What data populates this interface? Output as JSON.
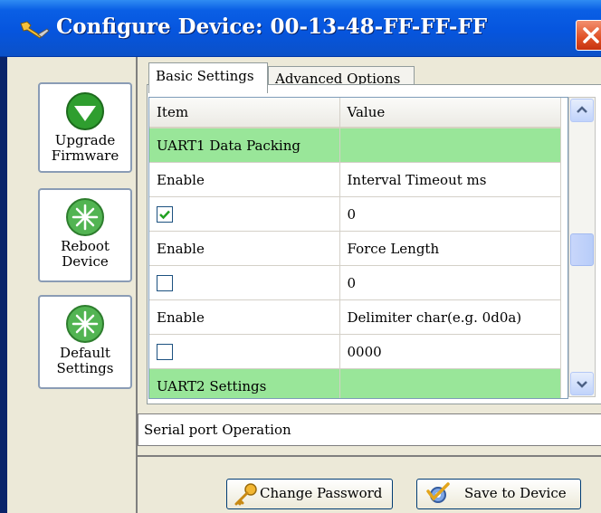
{
  "window": {
    "title": "Configure Device: 00-13-48-FF-FF-FF"
  },
  "sidebar": {
    "upgrade": {
      "label_line1": "Upgrade",
      "label_line2": "Firmware",
      "icon": "green-down-arrow-icon"
    },
    "reboot": {
      "label_line1": "Reboot",
      "label_line2": "Device",
      "icon": "green-starburst-icon"
    },
    "defaults": {
      "label_line1": "Default",
      "label_line2": "Settings",
      "icon": "green-starburst-icon"
    }
  },
  "tabs": [
    {
      "label": "Basic Settings",
      "active": true
    },
    {
      "label": "Advanced Options",
      "active": false
    }
  ],
  "grid": {
    "columns": [
      "Item",
      "Value"
    ],
    "rows": [
      {
        "type": "section",
        "item": "UART1 Data Packing",
        "value": ""
      },
      {
        "type": "text",
        "item": "Enable",
        "value": "Interval Timeout ms"
      },
      {
        "type": "checkbox",
        "checked": true,
        "value": "0"
      },
      {
        "type": "text",
        "item": "Enable",
        "value": "Force Length"
      },
      {
        "type": "checkbox",
        "checked": false,
        "value": "0"
      },
      {
        "type": "text",
        "item": "Enable",
        "value": "Delimiter char(e.g. 0d0a)"
      },
      {
        "type": "checkbox",
        "checked": false,
        "value": "0000"
      },
      {
        "type": "section",
        "item": "UART2 Settings",
        "value": ""
      }
    ]
  },
  "status": {
    "text": "Serial port Operation"
  },
  "buttons": {
    "change_password": "Change Password",
    "save_to_device": "Save to Device"
  },
  "colors": {
    "section_row": "#99e699",
    "titlebar": "#0655de",
    "close_button": "#e05025"
  }
}
